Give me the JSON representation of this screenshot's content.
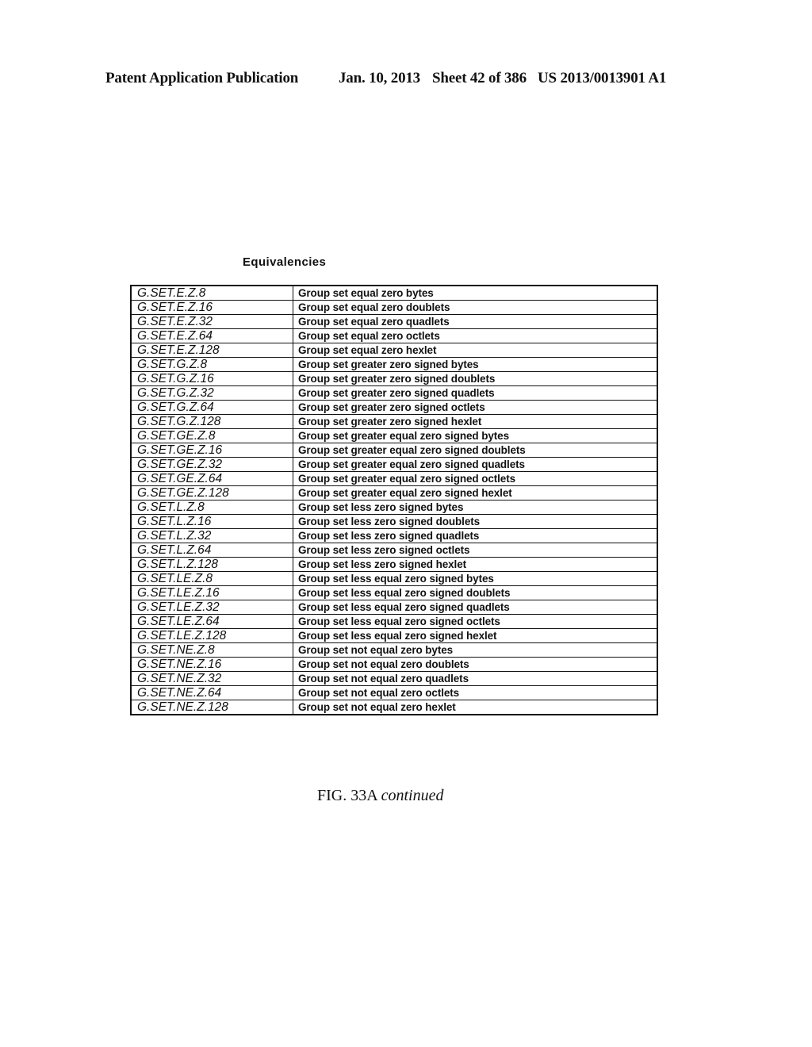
{
  "header": {
    "publication": "Patent Application Publication",
    "date": "Jan. 10, 2013",
    "sheet": "Sheet 42 of 386",
    "number": "US 2013/0013901 A1"
  },
  "table": {
    "title": "Equivalencies",
    "rows": [
      {
        "code": "G.SET.E.Z.8",
        "description": "Group set equal zero bytes"
      },
      {
        "code": "G.SET.E.Z.16",
        "description": "Group set equal zero doublets"
      },
      {
        "code": "G.SET.E.Z.32",
        "description": "Group set equal zero quadlets"
      },
      {
        "code": "G.SET.E.Z.64",
        "description": "Group set equal zero octlets"
      },
      {
        "code": "G.SET.E.Z.128",
        "description": "Group set equal zero hexlet"
      },
      {
        "code": "G.SET.G.Z.8",
        "description": "Group set greater zero signed bytes"
      },
      {
        "code": "G.SET.G.Z.16",
        "description": "Group set greater zero signed doublets"
      },
      {
        "code": "G.SET.G.Z.32",
        "description": "Group set greater zero signed quadlets"
      },
      {
        "code": "G.SET.G.Z.64",
        "description": "Group set greater zero signed octlets"
      },
      {
        "code": "G.SET.G.Z.128",
        "description": "Group set greater zero signed hexlet"
      },
      {
        "code": "G.SET.GE.Z.8",
        "description": "Group set greater equal zero signed bytes"
      },
      {
        "code": "G.SET.GE.Z.16",
        "description": "Group set greater equal zero signed doublets"
      },
      {
        "code": "G.SET.GE.Z.32",
        "description": "Group set greater equal zero signed quadlets"
      },
      {
        "code": "G.SET.GE.Z.64",
        "description": "Group set greater equal zero signed octlets"
      },
      {
        "code": "G.SET.GE.Z.128",
        "description": "Group set greater equal zero signed hexlet"
      },
      {
        "code": "G.SET.L.Z.8",
        "description": "Group set less zero signed bytes"
      },
      {
        "code": "G.SET.L.Z.16",
        "description": "Group set less zero signed doublets"
      },
      {
        "code": "G.SET.L.Z.32",
        "description": "Group set less zero signed quadlets"
      },
      {
        "code": "G.SET.L.Z.64",
        "description": "Group set less zero signed octlets"
      },
      {
        "code": "G.SET.L.Z.128",
        "description": "Group set less zero signed hexlet"
      },
      {
        "code": "G.SET.LE.Z.8",
        "description": "Group set less equal zero signed bytes"
      },
      {
        "code": "G.SET.LE.Z.16",
        "description": "Group set less equal zero signed doublets"
      },
      {
        "code": "G.SET.LE.Z.32",
        "description": "Group set less equal zero signed quadlets"
      },
      {
        "code": "G.SET.LE.Z.64",
        "description": "Group set less equal zero signed octlets"
      },
      {
        "code": "G.SET.LE.Z.128",
        "description": "Group set less equal zero signed hexlet"
      },
      {
        "code": "G.SET.NE.Z.8",
        "description": "Group set not equal zero bytes"
      },
      {
        "code": "G.SET.NE.Z.16",
        "description": "Group set not equal zero doublets"
      },
      {
        "code": "G.SET.NE.Z.32",
        "description": "Group set not equal zero quadlets"
      },
      {
        "code": "G.SET.NE.Z.64",
        "description": "Group set not equal zero octlets"
      },
      {
        "code": "G.SET.NE.Z.128",
        "description": "Group set not equal zero hexlet"
      }
    ]
  },
  "caption": {
    "figure": "FIG. 33A",
    "suffix": "continued"
  }
}
